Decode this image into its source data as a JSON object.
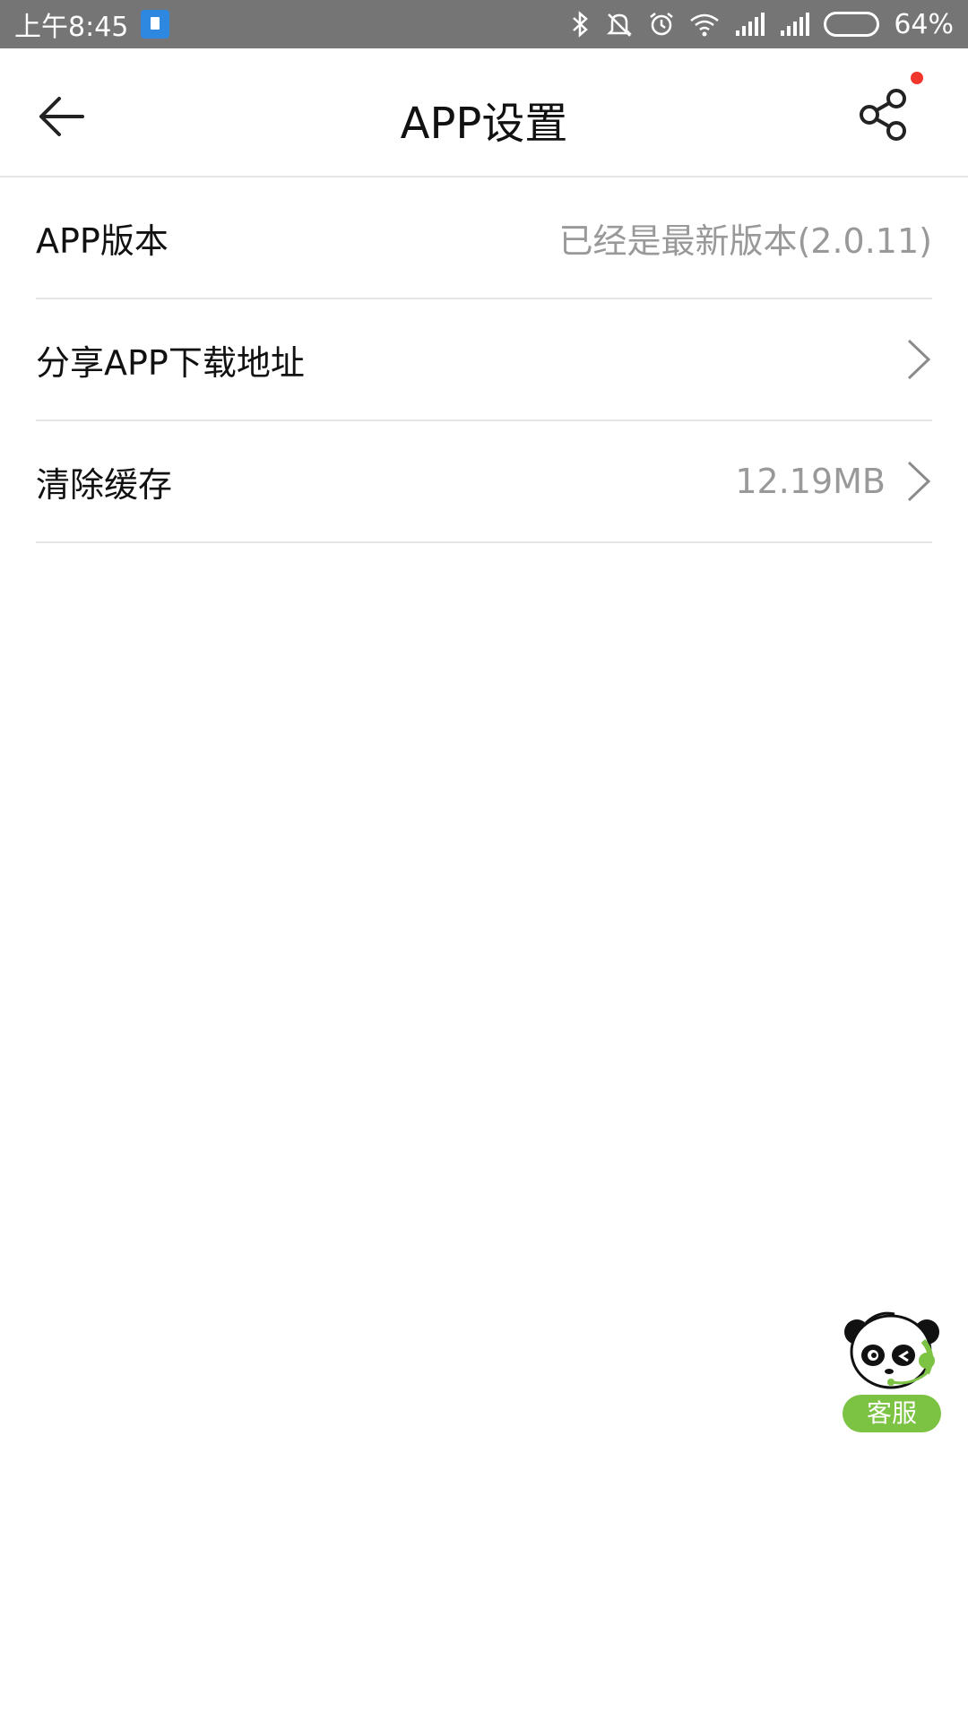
{
  "status_bar": {
    "time": "上午8:45",
    "battery_percent": "64%",
    "battery_level": 0.64,
    "icons": [
      "app-notification-icon",
      "bluetooth-icon",
      "mute-icon",
      "alarm-icon",
      "wifi-icon",
      "signal-icon",
      "signal-icon-2",
      "battery-icon"
    ]
  },
  "header": {
    "title": "APP设置",
    "back_icon": "arrow-left-icon",
    "share_icon": "share-icon",
    "notification_dot_color": "#f2362c"
  },
  "settings": [
    {
      "label": "APP版本",
      "value": "已经是最新版本(2.0.11)",
      "has_chevron": false
    },
    {
      "label": "分享APP下载地址",
      "value": "",
      "has_chevron": true
    },
    {
      "label": "清除缓存",
      "value": "12.19MB",
      "has_chevron": true
    }
  ],
  "customer_service": {
    "label": "客服",
    "icon": "panda-agent-icon",
    "accent_color": "#7cc243"
  }
}
